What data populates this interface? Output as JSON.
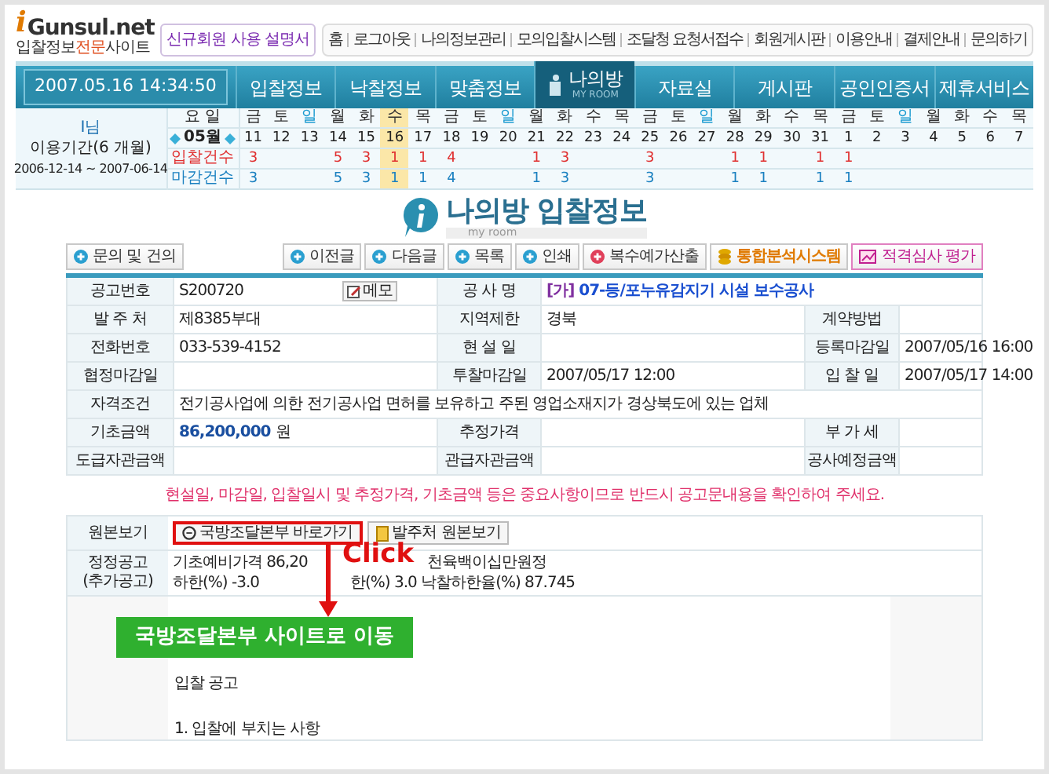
{
  "header": {
    "logo": {
      "mark": "i",
      "name": "Gunsul.net"
    },
    "tagline": [
      {
        "text": "입찰정보",
        "highlight": false
      },
      {
        "text": "전문",
        "highlight": true
      },
      {
        "text": "사이트",
        "highlight": false
      }
    ],
    "guide_link": "신규회원 사용 설명서",
    "links": [
      "홈",
      "로그아웃",
      "나의정보관리",
      "모의입찰시스템",
      "조달청 요청서접수",
      "회원게시판",
      "이용안내",
      "결제안내",
      "문의하기"
    ]
  },
  "nav": {
    "datetime": "2007.05.16 14:34:50",
    "items": [
      {
        "label": "입찰정보",
        "selected": false
      },
      {
        "label": "낙찰정보",
        "selected": false
      },
      {
        "label": "맞춤정보",
        "selected": false
      },
      {
        "label": "나의방",
        "sublabel": "MY ROOM",
        "selected": true
      },
      {
        "label": "자료실",
        "selected": false
      },
      {
        "label": "게시판",
        "selected": false
      },
      {
        "label": "공인인증서",
        "selected": false
      },
      {
        "label": "제휴서비스",
        "selected": false
      }
    ]
  },
  "calendar": {
    "user": "I님",
    "month": "05월",
    "period_label": "이용기간(6 개월)",
    "period": "2006-12-14 ~ 2007-06-14",
    "header_label": "요 일",
    "row_labels": [
      "입찰건수",
      "마감건수"
    ],
    "days": [
      {
        "weekday": "금",
        "date": "11",
        "sunday": false,
        "today": false,
        "bids": "3",
        "closings": "3"
      },
      {
        "weekday": "토",
        "date": "12",
        "sunday": false,
        "today": false
      },
      {
        "weekday": "일",
        "date": "13",
        "sunday": true,
        "today": false
      },
      {
        "weekday": "월",
        "date": "14",
        "sunday": false,
        "today": false,
        "bids": "5",
        "closings": "5"
      },
      {
        "weekday": "화",
        "date": "15",
        "sunday": false,
        "today": false,
        "bids": "3",
        "closings": "3"
      },
      {
        "weekday": "수",
        "date": "16",
        "sunday": false,
        "today": true,
        "bids": "1",
        "closings": "1"
      },
      {
        "weekday": "목",
        "date": "17",
        "sunday": false,
        "today": false,
        "bids": "1",
        "closings": "1"
      },
      {
        "weekday": "금",
        "date": "18",
        "sunday": false,
        "today": false,
        "bids": "4",
        "closings": "4"
      },
      {
        "weekday": "토",
        "date": "19",
        "sunday": false,
        "today": false
      },
      {
        "weekday": "일",
        "date": "20",
        "sunday": true,
        "today": false
      },
      {
        "weekday": "월",
        "date": "21",
        "sunday": false,
        "today": false,
        "bids": "1",
        "closings": "1"
      },
      {
        "weekday": "화",
        "date": "22",
        "sunday": false,
        "today": false,
        "bids": "3",
        "closings": "3"
      },
      {
        "weekday": "수",
        "date": "23",
        "sunday": false,
        "today": false
      },
      {
        "weekday": "목",
        "date": "24",
        "sunday": false,
        "today": false
      },
      {
        "weekday": "금",
        "date": "25",
        "sunday": false,
        "today": false,
        "bids": "3",
        "closings": "3"
      },
      {
        "weekday": "토",
        "date": "26",
        "sunday": false,
        "today": false
      },
      {
        "weekday": "일",
        "date": "27",
        "sunday": true,
        "today": false
      },
      {
        "weekday": "월",
        "date": "28",
        "sunday": false,
        "today": false,
        "bids": "1",
        "closings": "1"
      },
      {
        "weekday": "화",
        "date": "29",
        "sunday": false,
        "today": false,
        "bids": "1",
        "closings": "1"
      },
      {
        "weekday": "수",
        "date": "30",
        "sunday": false,
        "today": false
      },
      {
        "weekday": "목",
        "date": "31",
        "sunday": false,
        "today": false,
        "bids": "1",
        "closings": "1"
      },
      {
        "weekday": "금",
        "date": "1",
        "sunday": false,
        "today": false,
        "bids": "1",
        "closings": "1"
      },
      {
        "weekday": "토",
        "date": "2",
        "sunday": false,
        "today": false
      },
      {
        "weekday": "일",
        "date": "3",
        "sunday": true,
        "today": false
      },
      {
        "weekday": "월",
        "date": "4",
        "sunday": false,
        "today": false
      },
      {
        "weekday": "화",
        "date": "5",
        "sunday": false,
        "today": false
      },
      {
        "weekday": "수",
        "date": "6",
        "sunday": false,
        "today": false
      },
      {
        "weekday": "목",
        "date": "7",
        "sunday": false,
        "today": false
      }
    ]
  },
  "page_title": {
    "title": "나의방 입찰정보",
    "subtitle": "my room"
  },
  "toolbar": {
    "left": [
      {
        "label": "문의 및 건의",
        "kind": "plain"
      }
    ],
    "right": [
      {
        "label": "이전글",
        "kind": "plain"
      },
      {
        "label": "다음글",
        "kind": "plain"
      },
      {
        "label": "목록",
        "kind": "plain"
      },
      {
        "label": "인쇄",
        "kind": "plain"
      },
      {
        "label": "복수예가산출",
        "kind": "alert"
      },
      {
        "label": "통합분석시스템",
        "kind": "analysis"
      },
      {
        "label": "적격심사 평가",
        "kind": "evaluation"
      }
    ]
  },
  "details": [
    [
      {
        "label": "공고번호",
        "value": "S200720",
        "memo": "메모"
      },
      {
        "label": "공 사 명",
        "tag": "[가]",
        "value": "07-등/포누유감지기 시설 보수공사",
        "kind": "title"
      }
    ],
    [
      {
        "label": "발 주 처",
        "value": "제8385부대"
      },
      {
        "label": "지역제한",
        "value": "경북"
      },
      {
        "label": "계약방법"
      }
    ],
    [
      {
        "label": "전화번호",
        "value": "033-539-4152"
      },
      {
        "label": "현 설 일"
      },
      {
        "label": "등록마감일",
        "value": "2007/05/16 16:00"
      }
    ],
    [
      {
        "label": "협정마감일"
      },
      {
        "label": "투찰마감일",
        "value": "2007/05/17 12:00"
      },
      {
        "label": "입 찰 일",
        "value": "2007/05/17 14:00"
      }
    ],
    [
      {
        "label": "자격조건",
        "value": "전기공사업에 의한 전기공사업 면허를 보유하고 주된 영업소재지가 경상북도에 있는 업체"
      }
    ],
    [
      {
        "label": "기초금액",
        "value": "86,200,000",
        "unit": "원",
        "kind": "amount"
      },
      {
        "label": "추정가격"
      },
      {
        "label": "부 가 세"
      }
    ],
    [
      {
        "label": "도급자관금액"
      },
      {
        "label": "관급자관금액"
      },
      {
        "label": "공사예정금액"
      }
    ]
  ],
  "notice": "현설일, 마감일, 입찰일시 및 추정가격, 기초금액 등은 중요사항이므로 반드시 공고문내용을 확인하여 주세요.",
  "original": {
    "label": "원본보기",
    "buttons": [
      {
        "label": "국방조달본부 바로가기",
        "kind": "site",
        "highlighted": true
      },
      {
        "label": "발주처 원본보기",
        "kind": "file",
        "highlighted": false
      }
    ]
  },
  "amendment": {
    "label": "정정공고",
    "sublabel": "(추가공고)",
    "lines": [
      [
        "기초예비가격 86,20",
        "천육백이십만원정"
      ],
      [
        "하한(%) -3.0",
        "한(%) 3.0 낙찰하한율(%) 87.745"
      ]
    ]
  },
  "annotation": {
    "click": "Click",
    "banner": "국방조달본부 사이트로 이동"
  },
  "content": {
    "lines": [
      "입찰 공고",
      "1. 입찰에 부치는 사항"
    ]
  }
}
